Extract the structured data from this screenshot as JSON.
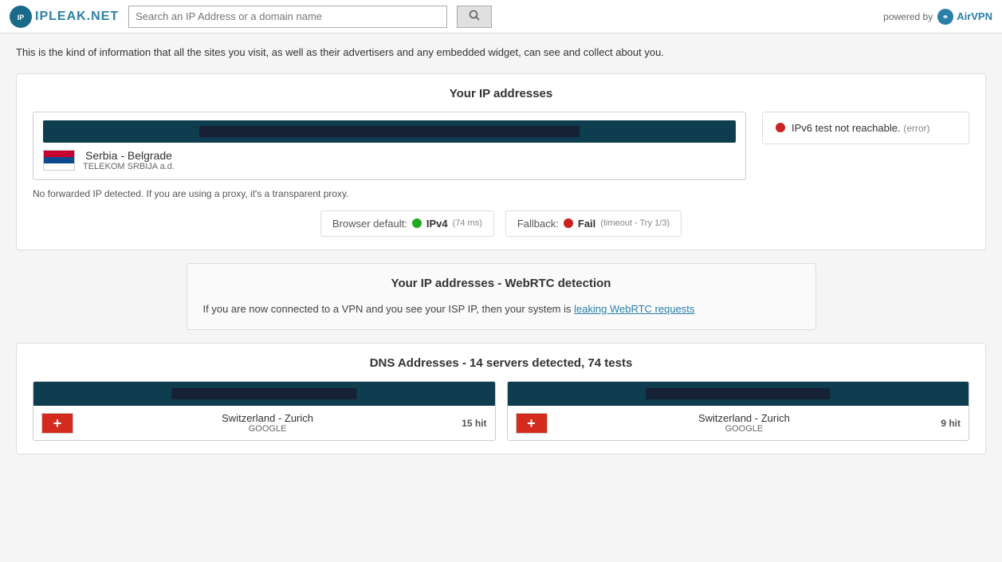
{
  "header": {
    "logo_text": "IPLEAK.NET",
    "search_placeholder": "Search an IP Address or a domain name",
    "search_button_label": "",
    "powered_by_label": "powered by",
    "airvpn_label": "AirVPN"
  },
  "info_text": "This is the kind of information that all the sites you visit, as well as their advertisers and any embedded widget, can see and collect about you.",
  "ip_section": {
    "title": "Your IP addresses",
    "location_name": "Serbia - Belgrade",
    "location_isp": "TELEKOM SRBIJA a.d.",
    "no_forward": "No forwarded IP detected. If you are using a proxy, it's a transparent proxy.",
    "ipv6_label": "IPv6 test not reachable.",
    "ipv6_error": "(error)",
    "browser_default_label": "Browser default:",
    "browser_default_protocol": "IPv4",
    "browser_default_speed": "(74 ms)",
    "fallback_label": "Fallback:",
    "fallback_status": "Fail",
    "fallback_meta": "(timeout - Try 1/3)"
  },
  "webrtc_section": {
    "title": "Your IP addresses - WebRTC detection",
    "info_text": "If you are now connected to a VPN and you see your ISP IP, then your system is",
    "link_text": "leaking WebRTC requests"
  },
  "dns_section": {
    "title": "DNS Addresses - 14 servers detected, 74 tests",
    "items": [
      {
        "location": "Switzerland - Zurich",
        "isp": "GOOGLE",
        "hits": "15 hit"
      },
      {
        "location": "Switzerland - Zurich",
        "isp": "GOOGLE",
        "hits": "9 hit"
      }
    ]
  }
}
